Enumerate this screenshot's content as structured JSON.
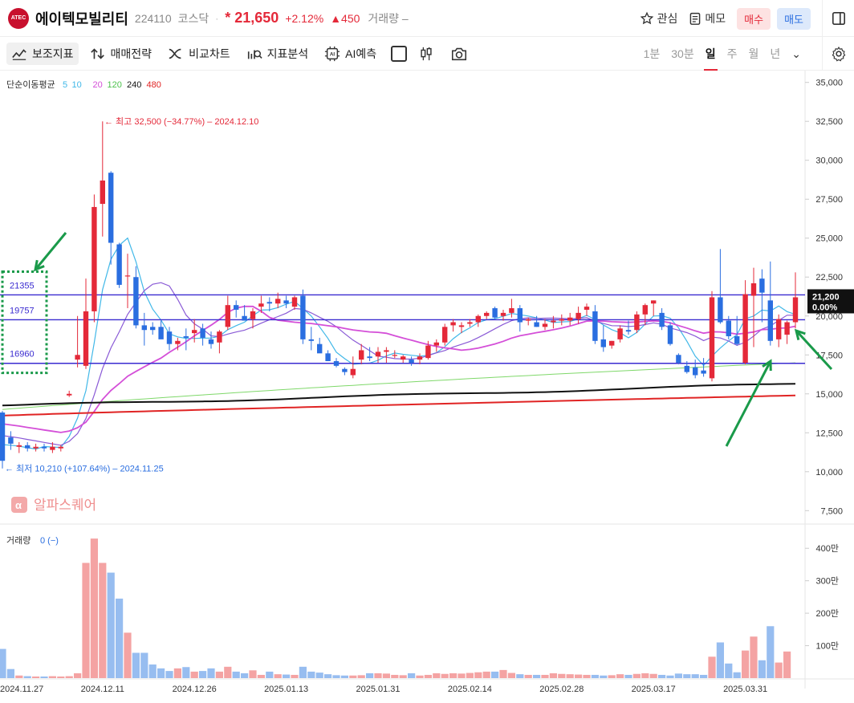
{
  "header": {
    "logo_text": "ATEC",
    "name": "에이텍모빌리티",
    "code": "224110",
    "market": "코스닥",
    "separator": "·",
    "price": "* 21,650",
    "change_pct": "+2.12%",
    "change_amt": "▲450",
    "volume_label": "거래량 –",
    "watch_label": "관심",
    "memo_label": "메모",
    "buy_label": "매수",
    "sell_label": "매도"
  },
  "toolbar": {
    "indicators_label": "보조지표",
    "strategy_label": "매매전략",
    "compare_label": "비교차트",
    "analysis_label": "지표분석",
    "ai_label": "AI예측",
    "periods": [
      "1분",
      "30분",
      "일",
      "주",
      "월",
      "년"
    ],
    "active_period": "일"
  },
  "colors": {
    "up": "#e42939",
    "down": "#2a6ee0",
    "ma5": "#41b8e8",
    "ma10": "#8a5ad6",
    "ma20": "#d44fd8",
    "ma120": "#7fd86a",
    "ma240": "#111111",
    "ma480": "#e02424",
    "level_line": "#3a2bd0",
    "annotation": "#1a9a4a"
  },
  "chart_data": {
    "type": "candlestick",
    "title": "",
    "ma_legend": {
      "label": "단순이동평균",
      "items": [
        {
          "period": "5",
          "color": "#41b8e8"
        },
        {
          "period": "10",
          "color": "#41b8e8"
        },
        {
          "period": "20",
          "color": "#d44fd8"
        },
        {
          "period": "120",
          "color": "#4cc24c"
        },
        {
          "period": "240",
          "color": "#111111"
        },
        {
          "period": "480",
          "color": "#e02424"
        }
      ]
    },
    "y_axis": {
      "min": 7000,
      "max": 35500,
      "ticks": [
        7500,
        10000,
        12500,
        15000,
        17500,
        20000,
        22500,
        25000,
        27500,
        30000,
        32500,
        35000
      ],
      "tick_labels": [
        "7,500",
        "10,000",
        "12,500",
        "15,000",
        "17,500",
        "20,000",
        "22,500",
        "25,000",
        "27,500",
        "30,000",
        "32,500",
        "35,000"
      ]
    },
    "current_price": {
      "value": 21200,
      "label": "21,200",
      "pct": "0.00%"
    },
    "high_annotation": {
      "value": 32500,
      "text": "최고 32,500 (−34.77%) – 2024.12.10"
    },
    "low_annotation": {
      "value": 10210,
      "text": "최저 10,210 (+107.64%) – 2024.11.25"
    },
    "horizontal_lines": [
      21355,
      19757,
      16960
    ],
    "level_labels": [
      "21355",
      "19757",
      "16960"
    ],
    "x_labels": [
      "2024.11.27",
      "2024.12.11",
      "2024.12.26",
      "2025.01.13",
      "2025.01.31",
      "2025.02.14",
      "2025.02.28",
      "2025.03.17",
      "2025.03.31"
    ],
    "x_label_index": [
      1,
      12,
      23,
      34,
      45,
      56,
      67,
      78,
      89
    ],
    "candles": [
      [
        13800,
        13900,
        10210,
        10700
      ],
      [
        12200,
        12600,
        11400,
        11800
      ],
      [
        11600,
        11900,
        11200,
        11700
      ],
      [
        11700,
        11900,
        11300,
        11500
      ],
      [
        11500,
        11800,
        11300,
        11600
      ],
      [
        11600,
        11800,
        11300,
        11500
      ],
      [
        11400,
        11900,
        11200,
        11600
      ],
      [
        11500,
        11700,
        11300,
        11600
      ],
      [
        14900,
        15200,
        14800,
        15000
      ],
      [
        17200,
        20000,
        16700,
        17500
      ],
      [
        16800,
        22400,
        16600,
        20300
      ],
      [
        20300,
        27800,
        19600,
        27000
      ],
      [
        27200,
        32500,
        25100,
        28700
      ],
      [
        29200,
        29300,
        23300,
        24700
      ],
      [
        24600,
        24700,
        21800,
        22000
      ],
      [
        22600,
        24000,
        20500,
        22600
      ],
      [
        22500,
        23200,
        19200,
        19400
      ],
      [
        19400,
        20200,
        18100,
        19100
      ],
      [
        19300,
        19600,
        18800,
        19100
      ],
      [
        19300,
        19700,
        18600,
        18500
      ],
      [
        19000,
        19300,
        17800,
        18200
      ],
      [
        18200,
        18600,
        17800,
        18400
      ],
      [
        18700,
        19200,
        17800,
        18600
      ],
      [
        18900,
        19800,
        18300,
        19100
      ],
      [
        19200,
        19500,
        18100,
        18600
      ],
      [
        18500,
        19000,
        17900,
        18200
      ],
      [
        18300,
        19100,
        17600,
        19000
      ],
      [
        19300,
        21300,
        19100,
        20700
      ],
      [
        20700,
        21000,
        19900,
        20400
      ],
      [
        20000,
        20700,
        19800,
        19700
      ],
      [
        19800,
        20500,
        19200,
        20300
      ],
      [
        20600,
        21300,
        20200,
        20800
      ],
      [
        20900,
        21200,
        20300,
        20800
      ],
      [
        20800,
        21500,
        20500,
        21100
      ],
      [
        21000,
        21300,
        20500,
        20800
      ],
      [
        20600,
        21300,
        20400,
        21200
      ],
      [
        21300,
        21700,
        18200,
        18500
      ],
      [
        18500,
        19300,
        17800,
        18400
      ],
      [
        18200,
        18600,
        17700,
        17600
      ],
      [
        17600,
        17800,
        17100,
        17100
      ],
      [
        17100,
        17300,
        16700,
        16800
      ],
      [
        16600,
        16700,
        16200,
        16400
      ],
      [
        16200,
        17400,
        16000,
        16600
      ],
      [
        17200,
        18200,
        16900,
        17800
      ],
      [
        17400,
        18000,
        17100,
        17300
      ],
      [
        17400,
        18000,
        17000,
        17700
      ],
      [
        17700,
        18000,
        17000,
        17800
      ],
      [
        17500,
        17800,
        17300,
        17500
      ],
      [
        17200,
        17500,
        17000,
        17400
      ],
      [
        17200,
        17400,
        16800,
        17000
      ],
      [
        17200,
        17600,
        16900,
        17400
      ],
      [
        17300,
        18400,
        17200,
        18100
      ],
      [
        18100,
        18500,
        17700,
        18300
      ],
      [
        18300,
        19500,
        18100,
        19300
      ],
      [
        19400,
        19800,
        19000,
        19600
      ],
      [
        19300,
        19600,
        18900,
        19400
      ],
      [
        19500,
        19800,
        19300,
        19600
      ],
      [
        19600,
        20100,
        19300,
        20000
      ],
      [
        20000,
        20300,
        19800,
        20200
      ],
      [
        20500,
        20600,
        19800,
        19900
      ],
      [
        20000,
        20400,
        19700,
        20200
      ],
      [
        20200,
        21100,
        19900,
        20500
      ],
      [
        20500,
        20700,
        19000,
        19600
      ],
      [
        19700,
        19900,
        19400,
        19800
      ],
      [
        19600,
        20000,
        19300,
        19300
      ],
      [
        19300,
        19800,
        19100,
        19500
      ],
      [
        19600,
        20000,
        19200,
        19700
      ],
      [
        19700,
        20100,
        19400,
        19800
      ],
      [
        19700,
        20200,
        19400,
        19900
      ],
      [
        19800,
        20600,
        19500,
        20200
      ],
      [
        20400,
        20800,
        20000,
        20600
      ],
      [
        20300,
        20700,
        18200,
        18400
      ],
      [
        18500,
        19400,
        17700,
        18000
      ],
      [
        18100,
        18400,
        17900,
        18400
      ],
      [
        18500,
        19400,
        18300,
        19200
      ],
      [
        19100,
        19700,
        18800,
        19000
      ],
      [
        19100,
        20300,
        18900,
        20100
      ],
      [
        20100,
        20800,
        19400,
        20700
      ],
      [
        20800,
        21000,
        20000,
        21000
      ],
      [
        20200,
        20500,
        19100,
        19300
      ],
      [
        19400,
        19600,
        18100,
        18200
      ],
      [
        17500,
        17600,
        16900,
        17000
      ],
      [
        16800,
        17100,
        16300,
        16400
      ],
      [
        16700,
        17200,
        16000,
        16200
      ],
      [
        16500,
        17300,
        16100,
        16300
      ],
      [
        16000,
        21600,
        15800,
        21200
      ],
      [
        21200,
        24300,
        19500,
        19600
      ],
      [
        19700,
        20000,
        18500,
        18700
      ],
      [
        18700,
        20000,
        18100,
        18200
      ],
      [
        17000,
        22300,
        16900,
        21400
      ],
      [
        21300,
        23100,
        18000,
        22100
      ],
      [
        22400,
        23000,
        19600,
        21500
      ],
      [
        21000,
        23500,
        18100,
        18400
      ],
      [
        18500,
        20100,
        18000,
        19800
      ],
      [
        18800,
        19700,
        18200,
        19600
      ],
      [
        19600,
        22800,
        19200,
        21200
      ]
    ],
    "volume": {
      "label": "거래량",
      "value_text": "0 (−)",
      "max": 450,
      "ticks": [
        100,
        200,
        300,
        400
      ],
      "tick_labels": [
        "100만",
        "200만",
        "300만",
        "400만"
      ],
      "values": [
        90,
        28,
        8,
        6,
        5,
        5,
        6,
        5,
        6,
        15,
        355,
        430,
        355,
        325,
        245,
        140,
        78,
        78,
        42,
        30,
        22,
        30,
        34,
        20,
        22,
        30,
        20,
        35,
        20,
        15,
        24,
        10,
        20,
        12,
        11,
        10,
        35,
        20,
        17,
        12,
        9,
        8,
        8,
        9,
        15,
        15,
        14,
        10,
        9,
        15,
        8,
        10,
        15,
        13,
        15,
        14,
        16,
        18,
        20,
        20,
        25,
        16,
        12,
        10,
        10,
        10,
        15,
        13,
        12,
        11,
        10,
        10,
        8,
        9,
        12,
        10,
        13,
        15,
        13,
        10,
        8,
        14,
        12,
        12,
        10,
        66,
        110,
        45,
        18,
        85,
        128,
        55,
        160,
        48,
        82
      ],
      "volume_colors_note": "up"
    }
  }
}
